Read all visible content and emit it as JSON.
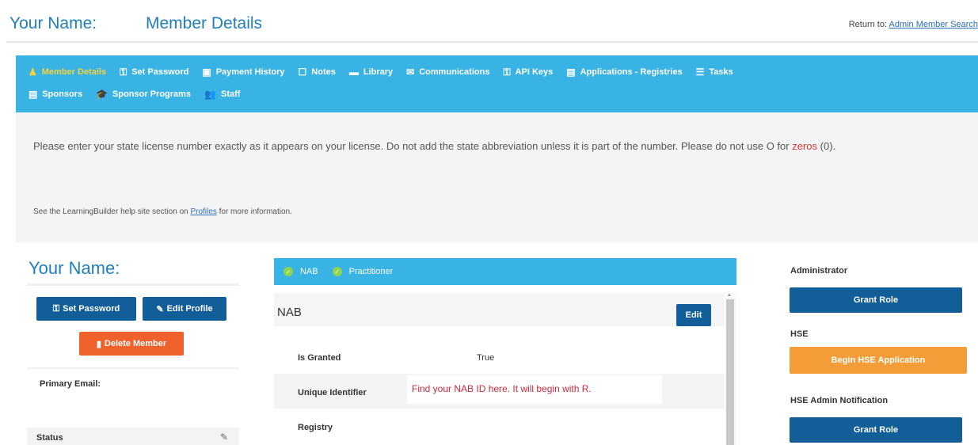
{
  "header": {
    "name_label": "Your Name:",
    "section_title": "Member Details",
    "return_prefix": "Return to:",
    "return_link": "Admin Member Search"
  },
  "nav": {
    "row1": [
      {
        "label": "Member Details",
        "icon": "user-icon",
        "glyph": "♟",
        "active": true
      },
      {
        "label": "Set Password",
        "icon": "key-icon",
        "glyph": "⚿",
        "active": false
      },
      {
        "label": "Payment History",
        "icon": "money-icon",
        "glyph": "▣",
        "active": false
      },
      {
        "label": "Notes",
        "icon": "note-icon",
        "glyph": "☐",
        "active": false
      },
      {
        "label": "Library",
        "icon": "folder-icon",
        "glyph": "▬",
        "active": false
      },
      {
        "label": "Communications",
        "icon": "envelope-icon",
        "glyph": "✉",
        "active": false
      },
      {
        "label": "API Keys",
        "icon": "key-icon",
        "glyph": "⚿",
        "active": false
      },
      {
        "label": "Applications - Registries",
        "icon": "list-icon",
        "glyph": "▤",
        "active": false
      },
      {
        "label": "Tasks",
        "icon": "tasks-icon",
        "glyph": "☰",
        "active": false
      }
    ],
    "row2": [
      {
        "label": "Sponsors",
        "icon": "document-icon",
        "glyph": "▤",
        "active": false
      },
      {
        "label": "Sponsor Programs",
        "icon": "graduation-cap-icon",
        "glyph": "🎓",
        "active": false
      },
      {
        "label": "Staff",
        "icon": "users-icon",
        "glyph": "👥",
        "active": false
      }
    ]
  },
  "info": {
    "message": "Please enter your state license number exactly as it appears on your license.  Do not add the state abbreviation unless it is part of the number.  Please do not use O for",
    "zeros": "zeros",
    "zeros_suffix": " (0).",
    "help_prefix": "See the LearningBuilder help site section on ",
    "help_link": "Profiles",
    "help_suffix": " for more information."
  },
  "profile": {
    "name": "Your Name:",
    "set_password": "Set Password",
    "edit_profile": "Edit Profile",
    "delete_member": "Delete Member",
    "primary_email_label": "Primary Email:",
    "status_label": "Status"
  },
  "roles": {
    "tabs": [
      "NAB",
      "Practitioner"
    ],
    "panel_title": "NAB",
    "edit_label": "Edit",
    "rows": [
      {
        "label": "Is Granted",
        "value": "True"
      },
      {
        "label": "Unique Identifier",
        "value": ""
      },
      {
        "label": "Registry",
        "value": ""
      }
    ],
    "callout": "Find your NAB ID here.  It will begin with R."
  },
  "sidebar": {
    "administrator_label": "Administrator",
    "grant_role_1": "Grant Role",
    "hse_label": "HSE",
    "begin_hse": "Begin HSE Application",
    "hse_admin_label": "HSE Admin Notification",
    "grant_role_2": "Grant Role"
  },
  "colors": {
    "primary_blue": "#1f7fbb",
    "nav_blue": "#39b3e4",
    "button_blue": "#125e98",
    "delete_orange": "#f0622b",
    "hse_orange": "#f39c38",
    "callout_red": "#d1283a",
    "active_nav": "#f5d33c"
  }
}
